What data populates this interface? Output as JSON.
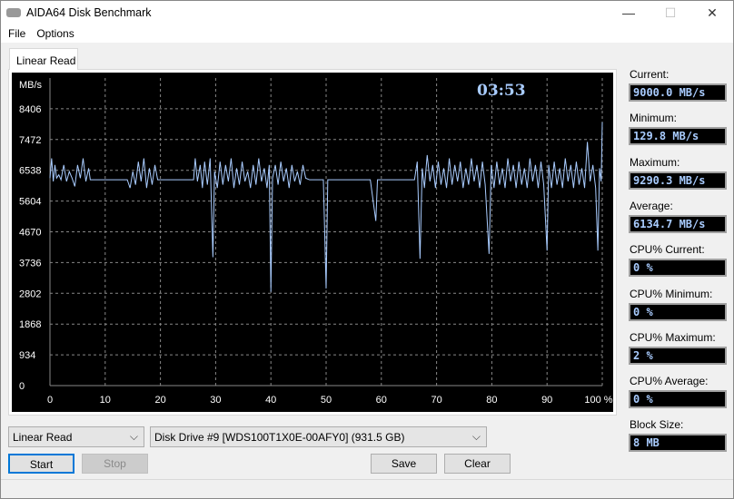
{
  "window": {
    "title": "AIDA64 Disk Benchmark",
    "minimize": "—",
    "maximize": "☐",
    "close": "✕"
  },
  "menu": [
    "File",
    "Options"
  ],
  "tab": "Linear Read",
  "chart_data": {
    "type": "line",
    "title": "",
    "timer": "03:53",
    "ylabel": "MB/s",
    "xlabel": "",
    "yticks": [
      0,
      934,
      1868,
      2802,
      3736,
      4670,
      5604,
      6538,
      7472,
      8406
    ],
    "xticks": [
      "0",
      "10",
      "20",
      "30",
      "40",
      "50",
      "60",
      "70",
      "80",
      "90",
      "100 %"
    ],
    "ylim": [
      0,
      9340
    ],
    "xlim": [
      0,
      100
    ],
    "grid": true,
    "color": "#a9ccff",
    "series": [
      {
        "name": "Linear Read",
        "points": [
          [
            0,
            6300
          ],
          [
            0.3,
            6900
          ],
          [
            0.6,
            6200
          ],
          [
            0.9,
            6700
          ],
          [
            1.2,
            6300
          ],
          [
            1.6,
            6400
          ],
          [
            2,
            6250
          ],
          [
            2.5,
            6700
          ],
          [
            3,
            6200
          ],
          [
            3.5,
            6500
          ],
          [
            4,
            6300
          ],
          [
            4.5,
            6050
          ],
          [
            5,
            6700
          ],
          [
            5.5,
            6300
          ],
          [
            6,
            6900
          ],
          [
            6.5,
            6200
          ],
          [
            7,
            6600
          ],
          [
            7.3,
            6250
          ],
          [
            10,
            6250
          ],
          [
            14,
            6250
          ],
          [
            14.5,
            6000
          ],
          [
            15,
            6500
          ],
          [
            15.5,
            6100
          ],
          [
            16,
            6800
          ],
          [
            16.5,
            6200
          ],
          [
            17,
            6900
          ],
          [
            17.5,
            6000
          ],
          [
            18,
            6600
          ],
          [
            18.5,
            6100
          ],
          [
            19,
            6700
          ],
          [
            19.5,
            6250
          ],
          [
            25,
            6250
          ],
          [
            26,
            6250
          ],
          [
            26.3,
            6900
          ],
          [
            26.7,
            6200
          ],
          [
            27.2,
            6700
          ],
          [
            27.6,
            6000
          ],
          [
            28,
            6800
          ],
          [
            28.5,
            6100
          ],
          [
            29,
            6900
          ],
          [
            29.5,
            3900
          ],
          [
            29.8,
            6500
          ],
          [
            30.3,
            6000
          ],
          [
            30.8,
            6800
          ],
          [
            31.3,
            6100
          ],
          [
            31.8,
            6700
          ],
          [
            32.3,
            6200
          ],
          [
            32.8,
            6900
          ],
          [
            33.3,
            6000
          ],
          [
            33.8,
            6600
          ],
          [
            34.3,
            6100
          ],
          [
            34.8,
            6800
          ],
          [
            35.3,
            6200
          ],
          [
            35.8,
            6500
          ],
          [
            36.3,
            6000
          ],
          [
            36.8,
            6700
          ],
          [
            37.3,
            6100
          ],
          [
            37.8,
            6900
          ],
          [
            38.3,
            6200
          ],
          [
            38.8,
            6600
          ],
          [
            39.3,
            6000
          ],
          [
            39.7,
            6700
          ],
          [
            40,
            2850
          ],
          [
            40.3,
            6300
          ],
          [
            40.8,
            6700
          ],
          [
            41.3,
            6100
          ],
          [
            41.8,
            6800
          ],
          [
            42.3,
            6200
          ],
          [
            42.8,
            6600
          ],
          [
            43.3,
            6000
          ],
          [
            43.8,
            6700
          ],
          [
            44.3,
            6200
          ],
          [
            44.8,
            6500
          ],
          [
            45.3,
            6100
          ],
          [
            45.8,
            6700
          ],
          [
            46.3,
            6300
          ],
          [
            47,
            6250
          ],
          [
            49.5,
            6250
          ],
          [
            50,
            2950
          ],
          [
            50.3,
            6250
          ],
          [
            58,
            6250
          ],
          [
            59,
            5000
          ],
          [
            59.3,
            6250
          ],
          [
            66,
            6250
          ],
          [
            66.5,
            6800
          ],
          [
            67,
            3850
          ],
          [
            67.4,
            6600
          ],
          [
            67.8,
            6000
          ],
          [
            68.3,
            7000
          ],
          [
            68.8,
            6200
          ],
          [
            69.3,
            6700
          ],
          [
            69.8,
            6000
          ],
          [
            70.3,
            6800
          ],
          [
            70.8,
            6100
          ],
          [
            71.3,
            6600
          ],
          [
            71.8,
            6000
          ],
          [
            72.3,
            6900
          ],
          [
            72.8,
            6100
          ],
          [
            73.3,
            6700
          ],
          [
            73.8,
            6200
          ],
          [
            74.3,
            6800
          ],
          [
            74.8,
            6000
          ],
          [
            75.3,
            6600
          ],
          [
            75.8,
            6100
          ],
          [
            76.3,
            6900
          ],
          [
            76.8,
            6200
          ],
          [
            77.3,
            6700
          ],
          [
            77.8,
            6000
          ],
          [
            78.3,
            6800
          ],
          [
            78.8,
            6100
          ],
          [
            79.5,
            4000
          ],
          [
            79.9,
            6700
          ],
          [
            80.4,
            6000
          ],
          [
            80.9,
            6800
          ],
          [
            81.4,
            6100
          ],
          [
            81.9,
            6600
          ],
          [
            82.4,
            6000
          ],
          [
            82.9,
            6900
          ],
          [
            83.4,
            6200
          ],
          [
            83.9,
            6700
          ],
          [
            84.4,
            6000
          ],
          [
            84.9,
            6800
          ],
          [
            85.4,
            6100
          ],
          [
            85.9,
            6600
          ],
          [
            86.4,
            6000
          ],
          [
            86.9,
            6900
          ],
          [
            87.4,
            6200
          ],
          [
            87.9,
            6700
          ],
          [
            88.4,
            6000
          ],
          [
            88.9,
            6800
          ],
          [
            89.4,
            6100
          ],
          [
            90,
            4100
          ],
          [
            90.3,
            6700
          ],
          [
            90.8,
            6000
          ],
          [
            91.3,
            6800
          ],
          [
            91.8,
            6100
          ],
          [
            92.3,
            6600
          ],
          [
            92.8,
            6000
          ],
          [
            93.3,
            6900
          ],
          [
            93.8,
            6200
          ],
          [
            94.3,
            6700
          ],
          [
            94.8,
            6000
          ],
          [
            95.3,
            6800
          ],
          [
            95.8,
            6100
          ],
          [
            96.3,
            6600
          ],
          [
            96.8,
            6000
          ],
          [
            97.3,
            7400
          ],
          [
            97.8,
            6200
          ],
          [
            98.3,
            6700
          ],
          [
            98.8,
            6000
          ],
          [
            99.2,
            4100
          ],
          [
            99.5,
            6600
          ],
          [
            99.8,
            6200
          ],
          [
            100,
            8000
          ]
        ]
      }
    ]
  },
  "stats": [
    {
      "label": "Current:",
      "value": "9000.0 MB/s"
    },
    {
      "label": "Minimum:",
      "value": "129.8 MB/s"
    },
    {
      "label": "Maximum:",
      "value": "9290.3 MB/s"
    },
    {
      "label": "Average:",
      "value": "6134.7 MB/s"
    },
    {
      "label": "CPU% Current:",
      "value": "0 %"
    },
    {
      "label": "CPU% Minimum:",
      "value": "0 %"
    },
    {
      "label": "CPU% Maximum:",
      "value": "2 %"
    },
    {
      "label": "CPU% Average:",
      "value": "0 %"
    },
    {
      "label": "Block Size:",
      "value": "8 MB"
    }
  ],
  "controls": {
    "test_select": "Linear Read",
    "drive_select": "Disk Drive #9  [WDS100T1X0E-00AFY0]  (931.5 GB)",
    "start": "Start",
    "stop": "Stop",
    "save": "Save",
    "clear": "Clear",
    "chevron": "⌵"
  }
}
